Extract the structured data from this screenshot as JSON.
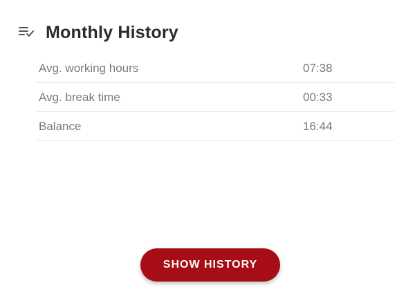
{
  "panel": {
    "title": "Monthly History",
    "title_icon": "playlist-check-icon"
  },
  "stats": [
    {
      "label": "Avg. working hours",
      "value": "07:38"
    },
    {
      "label": "Avg. break time",
      "value": "00:33"
    },
    {
      "label": "Balance",
      "value": "16:44"
    }
  ],
  "actions": {
    "show_history_label": "SHOW HISTORY"
  },
  "colors": {
    "accent": "#a60d15",
    "text_muted": "#7a7a7a",
    "divider": "#e6e6e6"
  }
}
